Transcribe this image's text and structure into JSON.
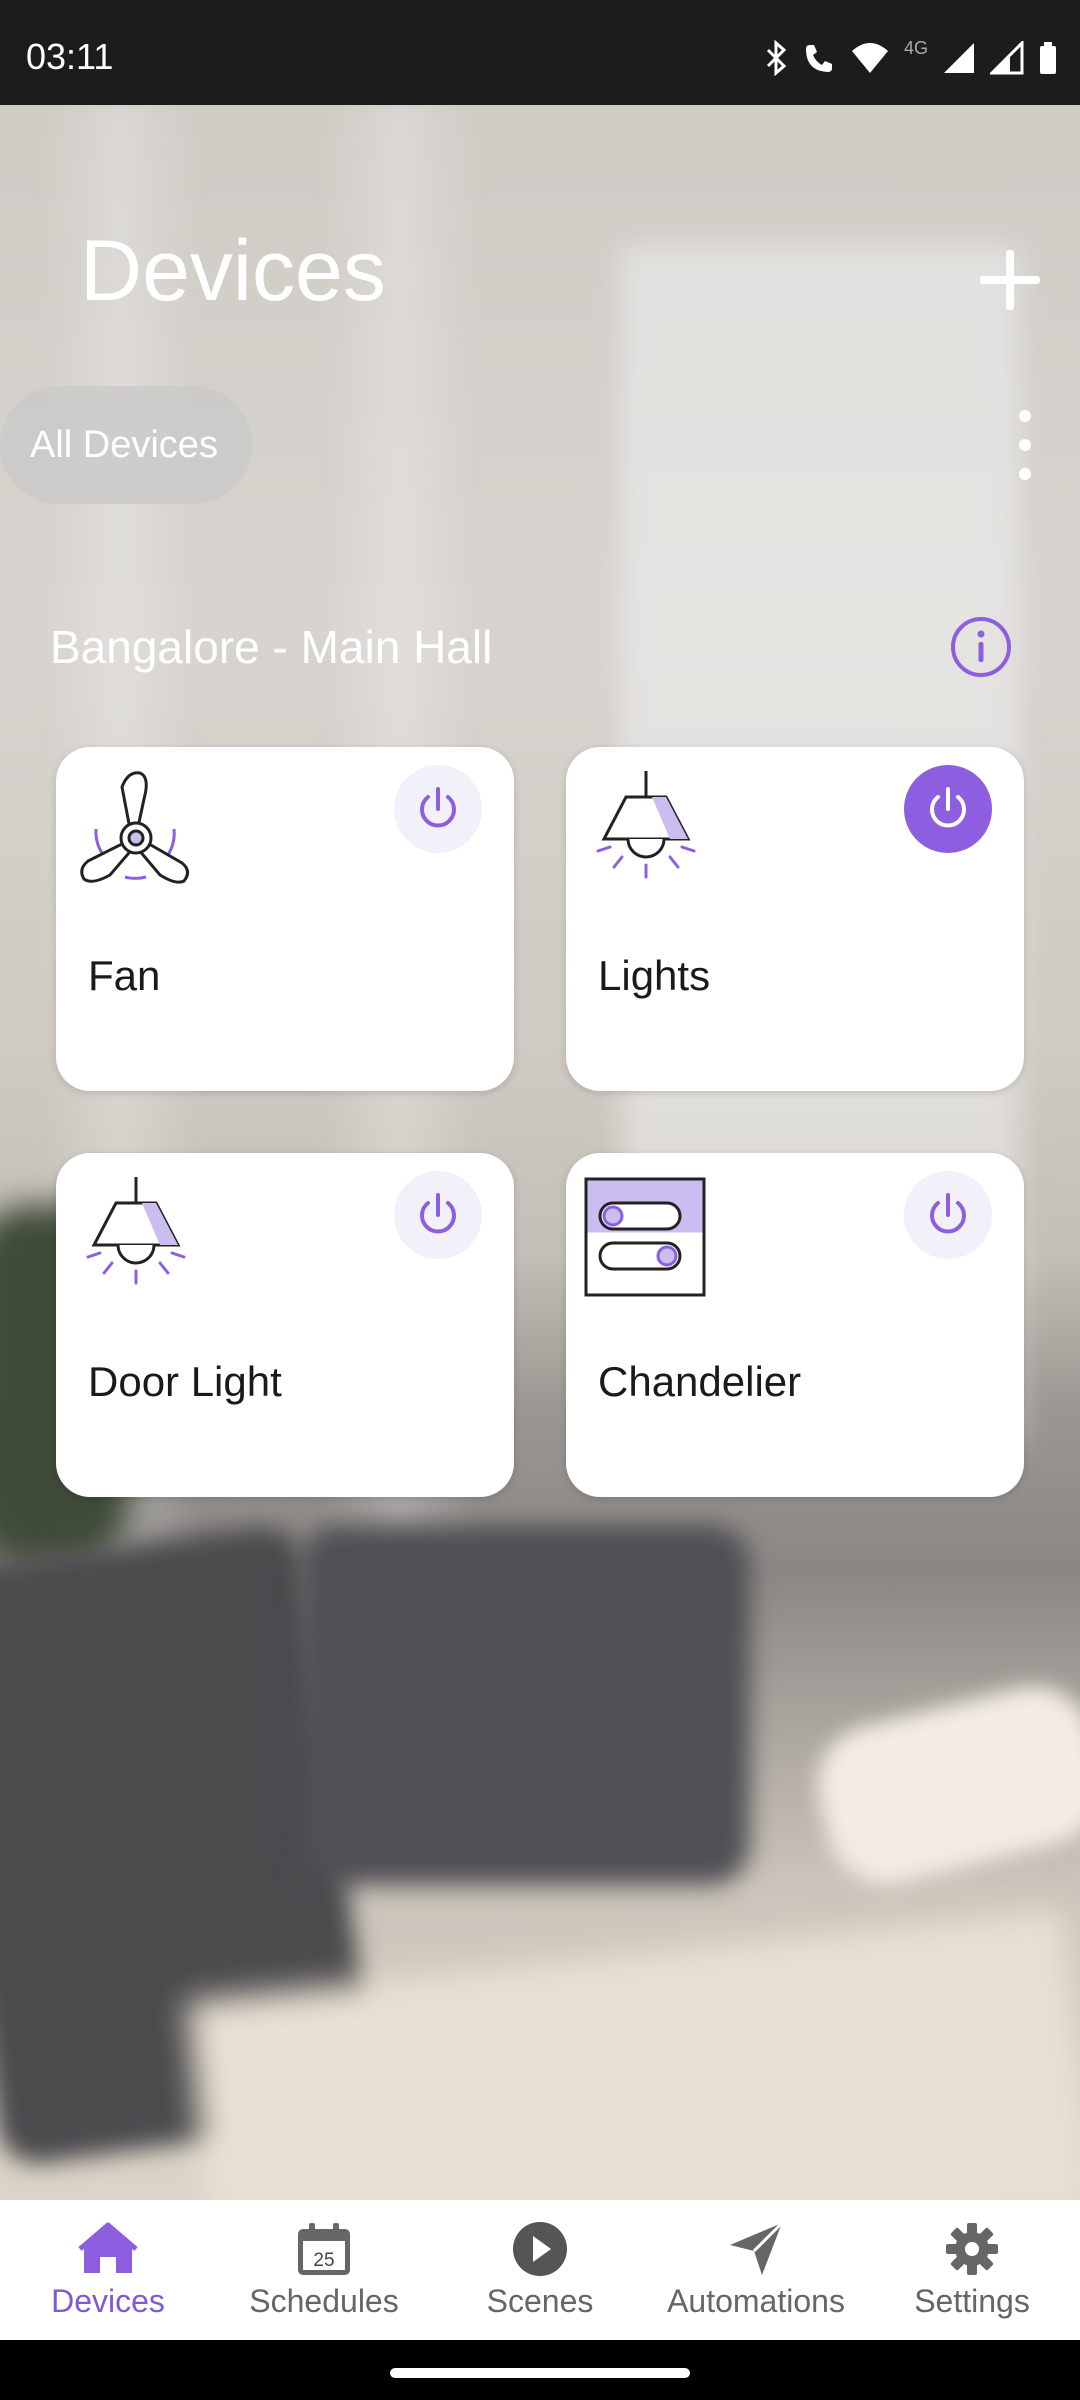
{
  "status": {
    "time": "03:11",
    "network": "4G"
  },
  "header": {
    "title": "Devices"
  },
  "filter": {
    "chip_label": "All Devices"
  },
  "room": {
    "name": "Bangalore - Main Hall"
  },
  "devices": [
    {
      "name": "Fan",
      "icon": "fan-icon",
      "power": "off"
    },
    {
      "name": "Lights",
      "icon": "ceiling-lamp-icon",
      "power": "on"
    },
    {
      "name": "Door Light",
      "icon": "ceiling-lamp-icon",
      "power": "off"
    },
    {
      "name": "Chandelier",
      "icon": "switch-icon",
      "power": "off"
    }
  ],
  "nav": [
    {
      "label": "Devices",
      "icon": "home-icon",
      "active": true
    },
    {
      "label": "Schedules",
      "icon": "calendar-icon",
      "day": "25"
    },
    {
      "label": "Scenes",
      "icon": "play-icon"
    },
    {
      "label": "Automations",
      "icon": "send-icon"
    },
    {
      "label": "Settings",
      "icon": "gear-icon"
    }
  ],
  "colors": {
    "accent": "#8d5fe0",
    "accent_light": "#cbbdf0",
    "card": "#ffffff"
  }
}
